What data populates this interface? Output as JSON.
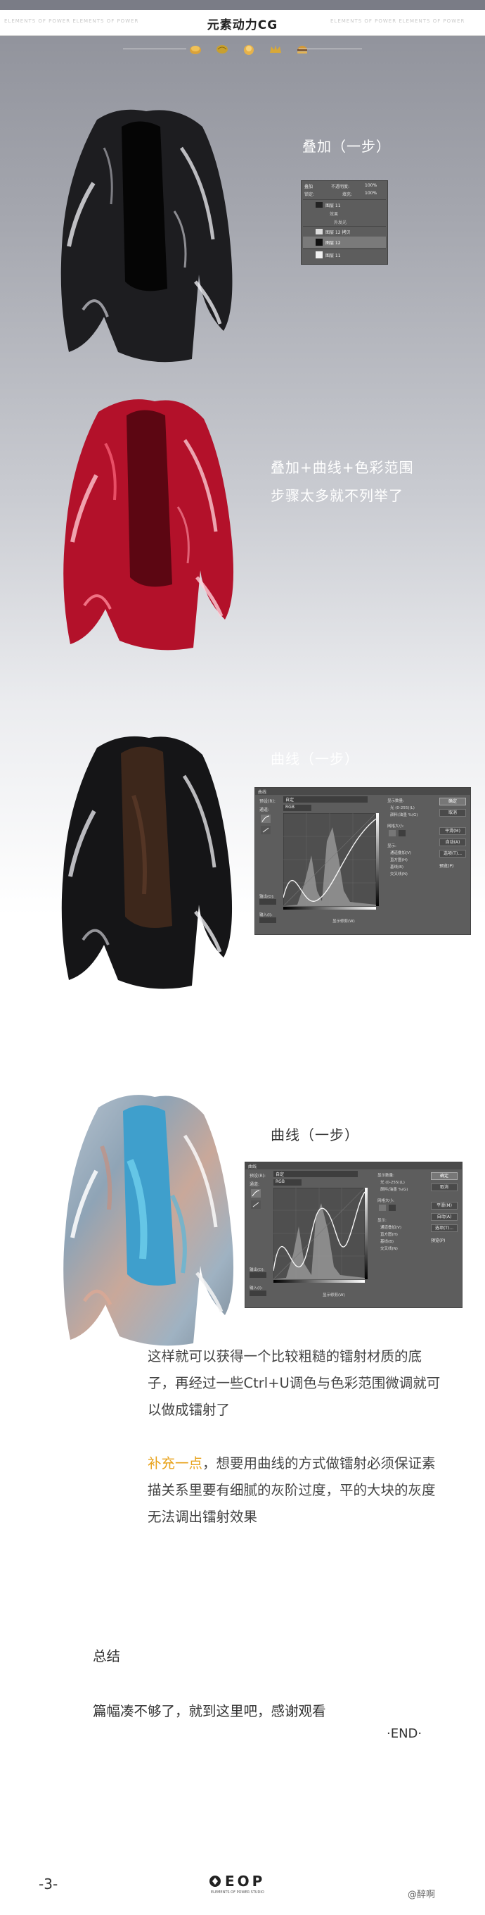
{
  "header": {
    "title": "元素动力CG",
    "watermark_left": "ELEMENTS OF POWER ELEMENTS OF POWER",
    "watermark_right": "ELEMENTS OF POWER ELEMENTS OF POWER"
  },
  "header_icons": [
    "bread-icon",
    "lemon-icon",
    "dumpling-icon",
    "crown-icon",
    "burger-icon"
  ],
  "sections": [
    {
      "caption": "叠加（一步）"
    },
    {
      "caption_line1": "叠加+曲线+色彩范围",
      "caption_line2": "步骤太多就不列举了"
    },
    {
      "caption": "曲线（一步）"
    },
    {
      "caption": "曲线（一步）"
    }
  ],
  "layers_panel": {
    "blend_mode": "叠加",
    "opacity_label": "不透明度:",
    "opacity_value": "100%",
    "fill_label": "填充:",
    "fill_value": "100%",
    "lock_label": "锁定:",
    "layers": [
      "图层 11",
      "效果",
      "外发光",
      "图层 12 拷贝",
      "图层 12",
      "图层 11"
    ]
  },
  "curves_dialog": {
    "title": "曲线",
    "preset_label": "预设(R):",
    "preset_value": "自定",
    "channel_label": "通道:",
    "channel_value": "RGB",
    "output_label": "输出(O):",
    "input_label": "输入(I):",
    "buttons": [
      "确定",
      "取消",
      "平滑(M)",
      "自动(A)",
      "选项(T)..."
    ],
    "display_title": "显示数量:",
    "display_options": [
      "光 (0-255)(L)",
      "颜料/油墨 %(G)"
    ],
    "grid_label": "网格大小:",
    "show_title": "显示:",
    "show_options": [
      "通道叠加(V)",
      "直方图(H)",
      "基线(B)",
      "交叉线(N)"
    ],
    "preview_label": "预览(P)",
    "show_clip_label": "显示修剪(W)"
  },
  "paragraphs": {
    "p1": "这样就可以获得一个比较粗糙的镭射材质的底子，再经过一些Ctrl+U调色与色彩范围微调就可以做成镭射了",
    "p2_highlight": "补充一点",
    "p2_rest": "，想要用曲线的方式做镭射必须保证素描关系里要有细腻的灰阶过度，平的大块的灰度无法调出镭射效果"
  },
  "summary": {
    "heading": "总结",
    "text": "篇幅凑不够了，就到这里吧，感谢观看",
    "end": "·END·"
  },
  "footer": {
    "page": "-3-",
    "logo": "EOP",
    "logo_sub": "ELEMENTS OF POWER STUDIO",
    "weibo": "@醉啊"
  },
  "colors": {
    "highlight": "#e8a31c",
    "jacket_black": "#1a1a1c",
    "jacket_red": "#c8102e",
    "jacket_brown": "#3a2418",
    "jacket_holo_blue": "#4aa8d0"
  }
}
